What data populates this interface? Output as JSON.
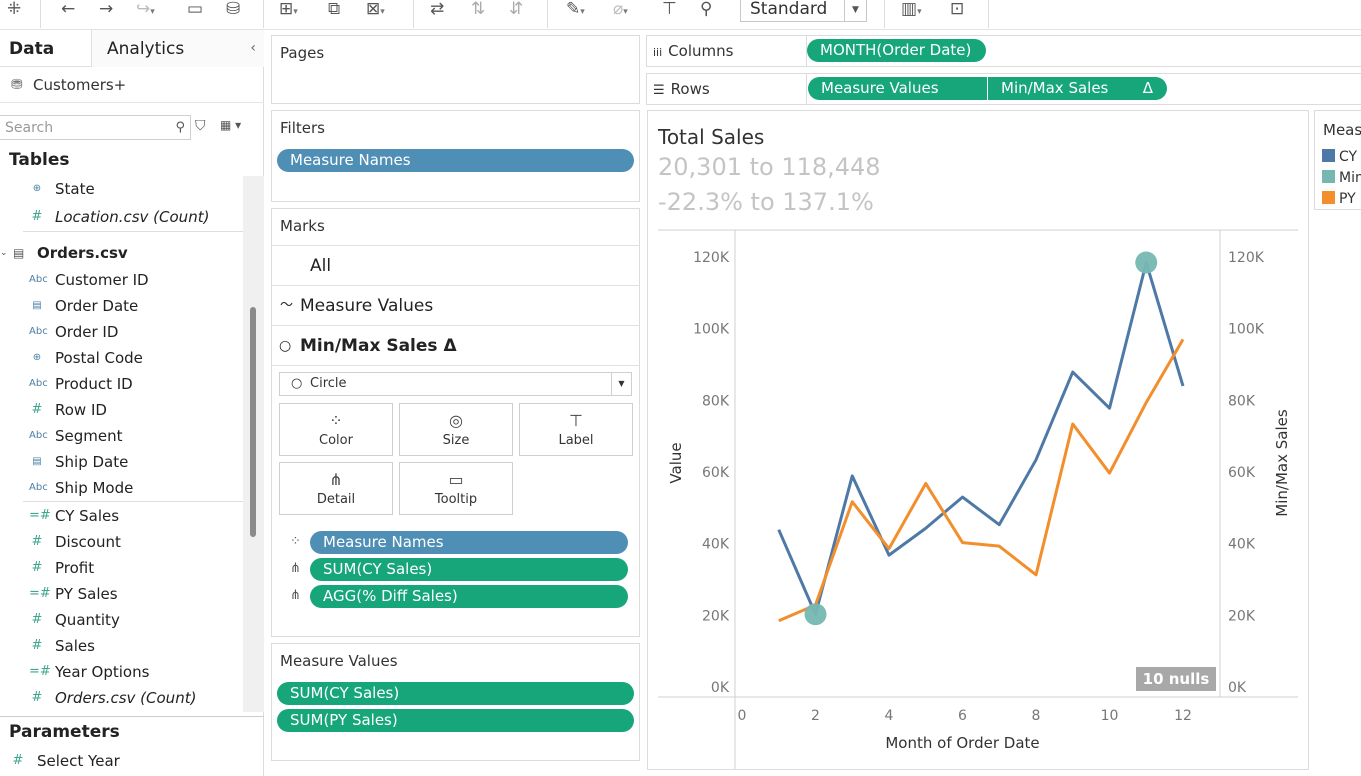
{
  "toolbar": {
    "view_mode": "Standard"
  },
  "data_pane": {
    "tabs": [
      "Data",
      "Analytics"
    ],
    "datasource": "Customers+",
    "search_placeholder": "Search",
    "tables_title": "Tables",
    "parameters_title": "Parameters",
    "fields_top": [
      {
        "name": "State",
        "type": "geo",
        "italic": false
      },
      {
        "name": "Location.csv (Count)",
        "type": "measure",
        "italic": true
      }
    ],
    "orders_table": "Orders.csv",
    "dimensions": [
      {
        "name": "Customer ID",
        "type": "abc"
      },
      {
        "name": "Order Date",
        "type": "date"
      },
      {
        "name": "Order ID",
        "type": "abc"
      },
      {
        "name": "Postal Code",
        "type": "geo"
      },
      {
        "name": "Product ID",
        "type": "abc"
      },
      {
        "name": "Row ID",
        "type": "measure"
      },
      {
        "name": "Segment",
        "type": "abc"
      },
      {
        "name": "Ship Date",
        "type": "date"
      },
      {
        "name": "Ship Mode",
        "type": "abc"
      }
    ],
    "measures": [
      {
        "name": "CY Sales",
        "type": "calc",
        "italic": false
      },
      {
        "name": "Discount",
        "type": "measure",
        "italic": false
      },
      {
        "name": "Profit",
        "type": "measure",
        "italic": false
      },
      {
        "name": "PY Sales",
        "type": "calc",
        "italic": false
      },
      {
        "name": "Quantity",
        "type": "measure",
        "italic": false
      },
      {
        "name": "Sales",
        "type": "measure",
        "italic": false
      },
      {
        "name": "Year Options",
        "type": "calc",
        "italic": false
      },
      {
        "name": "Orders.csv (Count)",
        "type": "measure",
        "italic": true
      }
    ],
    "parameters": [
      {
        "name": "Select Year",
        "type": "calc"
      }
    ]
  },
  "pages": {
    "title": "Pages"
  },
  "filters": {
    "title": "Filters",
    "pills": [
      "Measure Names"
    ]
  },
  "marks": {
    "title": "Marks",
    "cards": [
      "All",
      "Measure Values",
      "Min/Max Sales Δ"
    ],
    "mark_type": "Circle",
    "buttons": [
      "Color",
      "Size",
      "Label",
      "Detail",
      "Tooltip"
    ],
    "pills": [
      "Measure Names",
      "SUM(CY Sales)",
      "AGG(% Diff Sales)"
    ]
  },
  "measure_values": {
    "title": "Measure Values",
    "pills": [
      "SUM(CY Sales)",
      "SUM(PY Sales)"
    ]
  },
  "columns": {
    "label": "Columns",
    "pills": [
      "MONTH(Order Date)"
    ]
  },
  "rows": {
    "label": "Rows",
    "pills": [
      "Measure Values",
      "Min/Max Sales"
    ],
    "delta": "Δ"
  },
  "view": {
    "title": "Total Sales",
    "subtitle1": "20,301 to 118,448",
    "subtitle2": "-22.3% to 137.1%",
    "nulls": "10 nulls"
  },
  "legend": {
    "title": "Meas",
    "items": [
      {
        "label": "CY S",
        "color": "#4e79a7"
      },
      {
        "label": "Min",
        "color": "#76b7b2"
      },
      {
        "label": "PY S",
        "color": "#f28e2b"
      }
    ]
  },
  "chart_data": {
    "type": "line",
    "xlabel": "Month of Order Date",
    "ylabel": "Value",
    "y2label": "Min/Max Sales",
    "xlim": [
      0,
      12
    ],
    "xticks": [
      0,
      2,
      4,
      6,
      8,
      10,
      12
    ],
    "ylim": [
      0,
      120000
    ],
    "yticks": [
      "0K",
      "20K",
      "40K",
      "60K",
      "80K",
      "100K",
      "120K"
    ],
    "series": [
      {
        "name": "CY Sales",
        "color": "#4e79a7",
        "x": [
          1,
          2,
          3,
          4,
          5,
          6,
          7,
          8,
          9,
          10,
          11,
          12
        ],
        "values": [
          43900,
          20301,
          58900,
          36800,
          44300,
          53000,
          45300,
          63400,
          87900,
          77800,
          118448,
          84000
        ]
      },
      {
        "name": "PY Sales",
        "color": "#f28e2b",
        "x": [
          1,
          2,
          3,
          4,
          5,
          6,
          7,
          8,
          9,
          10,
          11,
          12
        ],
        "values": [
          18500,
          22900,
          51700,
          38600,
          56800,
          40300,
          39300,
          31300,
          73400,
          59700,
          79400,
          97000
        ]
      },
      {
        "name": "Min/Max Sales",
        "color": "#76b7b2",
        "x": [
          2,
          11
        ],
        "values": [
          20301,
          118448
        ],
        "mark": "circle"
      }
    ]
  }
}
